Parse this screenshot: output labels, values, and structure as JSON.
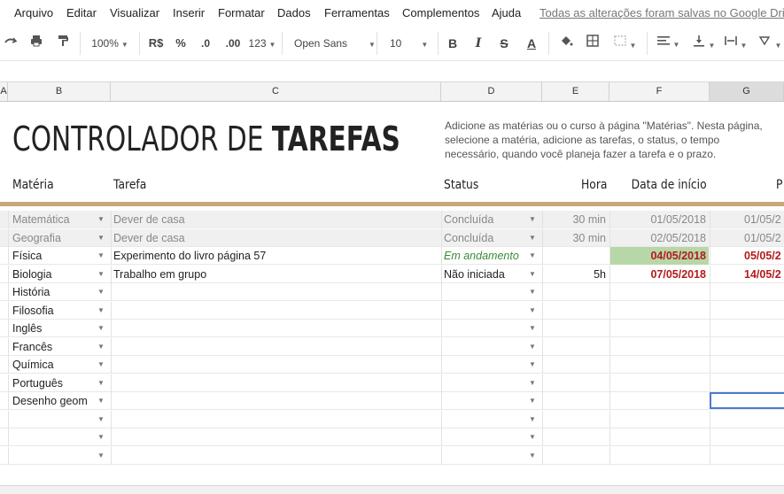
{
  "menu": {
    "items": [
      "Arquivo",
      "Editar",
      "Visualizar",
      "Inserir",
      "Formatar",
      "Dados",
      "Ferramentas",
      "Complementos",
      "Ajuda"
    ],
    "saved_status": "Todas as alterações foram salvas no Google Drive"
  },
  "toolbar": {
    "zoom": "100%",
    "currency": "R$",
    "percent": "%",
    "decimal_decrease": ".0",
    "decimal_increase": ".00",
    "more_formats": "123",
    "font": "Open Sans",
    "font_size": "10",
    "bold": "B",
    "italic": "I",
    "strikethrough": "S",
    "text_color": "A"
  },
  "columns": [
    "A",
    "B",
    "C",
    "D",
    "E",
    "F",
    "G"
  ],
  "sheet": {
    "title_light": "CONTROLADOR DE ",
    "title_bold": "TAREFAS",
    "description": [
      "Adicione as matérias ou o curso à página \"Matérias\". Nesta página,",
      "selecione a matéria, adicione as tarefas, o status, o tempo",
      "necessário, quando você planeja fazer a tarefa e o prazo."
    ],
    "headers": {
      "subject": "Matéria",
      "task": "Tarefa",
      "status": "Status",
      "hours": "Hora",
      "start_date": "Data de início",
      "due": "P"
    }
  },
  "rows": [
    {
      "subject": "Matemática",
      "task": "Dever de casa",
      "status": "Concluída",
      "hours": "30 min",
      "start": "01/05/2018",
      "due": "01/05/2",
      "state": "done"
    },
    {
      "subject": "Geografia",
      "task": "Dever de casa",
      "status": "Concluída",
      "hours": "30 min",
      "start": "02/05/2018",
      "due": "01/05/2",
      "state": "done"
    },
    {
      "subject": "Física",
      "task": "Experimento do livro página 57",
      "status": "Em andamento",
      "hours": "",
      "start": "04/05/2018",
      "due": "05/05/2",
      "state": "progress"
    },
    {
      "subject": "Biologia",
      "task": "Trabalho em grupo",
      "status": "Não iniciada",
      "hours": "5h",
      "start": "07/05/2018",
      "due": "14/05/2",
      "state": "todo"
    },
    {
      "subject": "História",
      "task": "",
      "status": "",
      "hours": "",
      "start": "",
      "due": "",
      "state": "empty"
    },
    {
      "subject": "Filosofia",
      "task": "",
      "status": "",
      "hours": "",
      "start": "",
      "due": "",
      "state": "empty"
    },
    {
      "subject": "Inglês",
      "task": "",
      "status": "",
      "hours": "",
      "start": "",
      "due": "",
      "state": "empty"
    },
    {
      "subject": "Francês",
      "task": "",
      "status": "",
      "hours": "",
      "start": "",
      "due": "",
      "state": "empty"
    },
    {
      "subject": "Química",
      "task": "",
      "status": "",
      "hours": "",
      "start": "",
      "due": "",
      "state": "empty"
    },
    {
      "subject": "Português",
      "task": "",
      "status": "",
      "hours": "",
      "start": "",
      "due": "",
      "state": "empty"
    },
    {
      "subject": "Desenho geom",
      "task": "",
      "status": "",
      "hours": "",
      "start": "",
      "due": "",
      "state": "empty"
    },
    {
      "subject": "",
      "task": "",
      "status": "",
      "hours": "",
      "start": "",
      "due": "",
      "state": "empty"
    },
    {
      "subject": "",
      "task": "",
      "status": "",
      "hours": "",
      "start": "",
      "due": "",
      "state": "empty"
    },
    {
      "subject": "",
      "task": "",
      "status": "",
      "hours": "",
      "start": "",
      "due": "",
      "state": "empty"
    }
  ],
  "colors": {
    "accent_line": "#c8a87a",
    "progress_green": "#3a8a3a",
    "overdue_red": "#b31b1b",
    "start_highlight": "#b7d7a8",
    "selection_blue": "#4a7bd0"
  }
}
